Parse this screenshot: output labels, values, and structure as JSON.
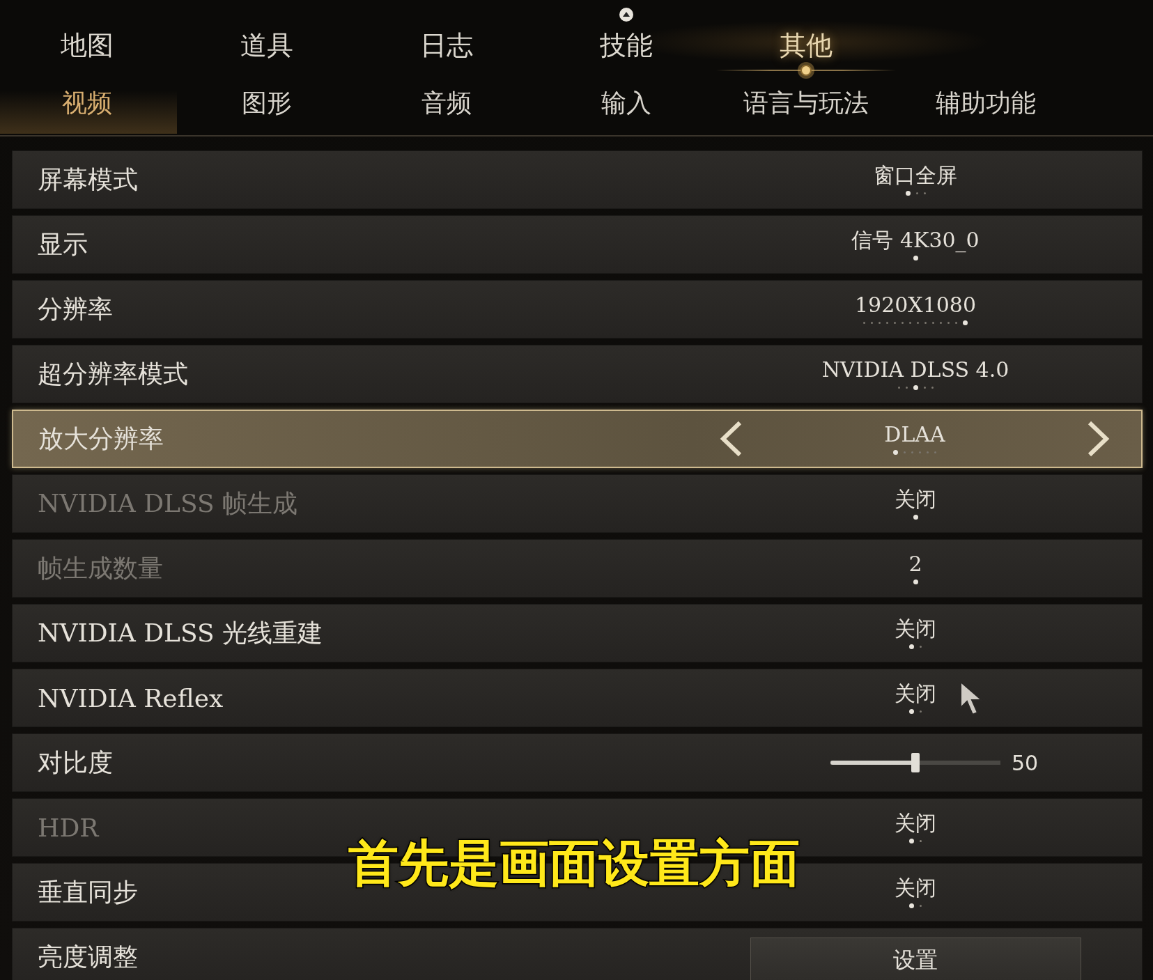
{
  "top_tabs": [
    {
      "label": "地图",
      "selected": false,
      "badge": false
    },
    {
      "label": "道具",
      "selected": false,
      "badge": false
    },
    {
      "label": "日志",
      "selected": false,
      "badge": false
    },
    {
      "label": "技能",
      "selected": false,
      "badge": true
    },
    {
      "label": "其他",
      "selected": true,
      "badge": false
    }
  ],
  "sub_tabs": [
    {
      "label": "视频",
      "selected": true
    },
    {
      "label": "图形",
      "selected": false
    },
    {
      "label": "音频",
      "selected": false
    },
    {
      "label": "输入",
      "selected": false
    },
    {
      "label": "语言与玩法",
      "selected": false
    },
    {
      "label": "辅助功能",
      "selected": false
    }
  ],
  "settings": [
    {
      "kind": "select",
      "label": "屏幕模式",
      "value": "窗口全屏",
      "disabled": false,
      "focused": false,
      "dots": [
        {
          "selected": true
        },
        {
          "selected": false
        },
        {
          "selected": false
        }
      ]
    },
    {
      "kind": "select",
      "label": "显示",
      "value": "信号 4K30_0",
      "disabled": false,
      "focused": false,
      "dots": [
        {
          "selected": true
        }
      ]
    },
    {
      "kind": "select",
      "label": "分辨率",
      "value": "1920X1080",
      "disabled": false,
      "focused": false,
      "dots": [
        {
          "selected": false
        },
        {
          "selected": false
        },
        {
          "selected": false
        },
        {
          "selected": false
        },
        {
          "selected": false
        },
        {
          "selected": false
        },
        {
          "selected": false
        },
        {
          "selected": false
        },
        {
          "selected": false
        },
        {
          "selected": false
        },
        {
          "selected": false
        },
        {
          "selected": false
        },
        {
          "selected": false
        },
        {
          "selected": true
        }
      ]
    },
    {
      "kind": "select",
      "label": "超分辨率模式",
      "value": "NVIDIA DLSS 4.0",
      "disabled": false,
      "focused": false,
      "dots": [
        {
          "selected": false
        },
        {
          "selected": false
        },
        {
          "selected": true
        },
        {
          "selected": false
        },
        {
          "selected": false
        }
      ]
    },
    {
      "kind": "select",
      "label": "放大分辨率",
      "value": "DLAA",
      "disabled": false,
      "focused": true,
      "dots": [
        {
          "selected": true
        },
        {
          "selected": false
        },
        {
          "selected": false
        },
        {
          "selected": false
        },
        {
          "selected": false
        },
        {
          "selected": false
        }
      ]
    },
    {
      "kind": "select",
      "label": "NVIDIA DLSS 帧生成",
      "value": "关闭",
      "disabled": true,
      "focused": false,
      "dots": [
        {
          "selected": true
        }
      ]
    },
    {
      "kind": "select",
      "label": "帧生成数量",
      "value": "2",
      "disabled": true,
      "focused": false,
      "dots": [
        {
          "selected": true
        }
      ]
    },
    {
      "kind": "select",
      "label": "NVIDIA DLSS 光线重建",
      "value": "关闭",
      "disabled": false,
      "focused": false,
      "dots": [
        {
          "selected": true
        },
        {
          "selected": false
        }
      ]
    },
    {
      "kind": "select",
      "label": "NVIDIA Reflex",
      "value": "关闭",
      "disabled": false,
      "focused": false,
      "dots": [
        {
          "selected": true
        },
        {
          "selected": false
        }
      ]
    },
    {
      "kind": "slider",
      "label": "对比度",
      "level": 0.5,
      "reading": "50"
    },
    {
      "kind": "select",
      "label": "HDR",
      "value": "关闭",
      "disabled": true,
      "focused": false,
      "dots": [
        {
          "selected": true
        },
        {
          "selected": false
        }
      ]
    },
    {
      "kind": "select",
      "label": "垂直同步",
      "value": "关闭",
      "disabled": false,
      "focused": false,
      "dots": [
        {
          "selected": true
        },
        {
          "selected": false
        }
      ]
    },
    {
      "kind": "button",
      "label": "亮度调整",
      "button": "设置"
    }
  ],
  "subtitle": "首先是画面设置方面"
}
